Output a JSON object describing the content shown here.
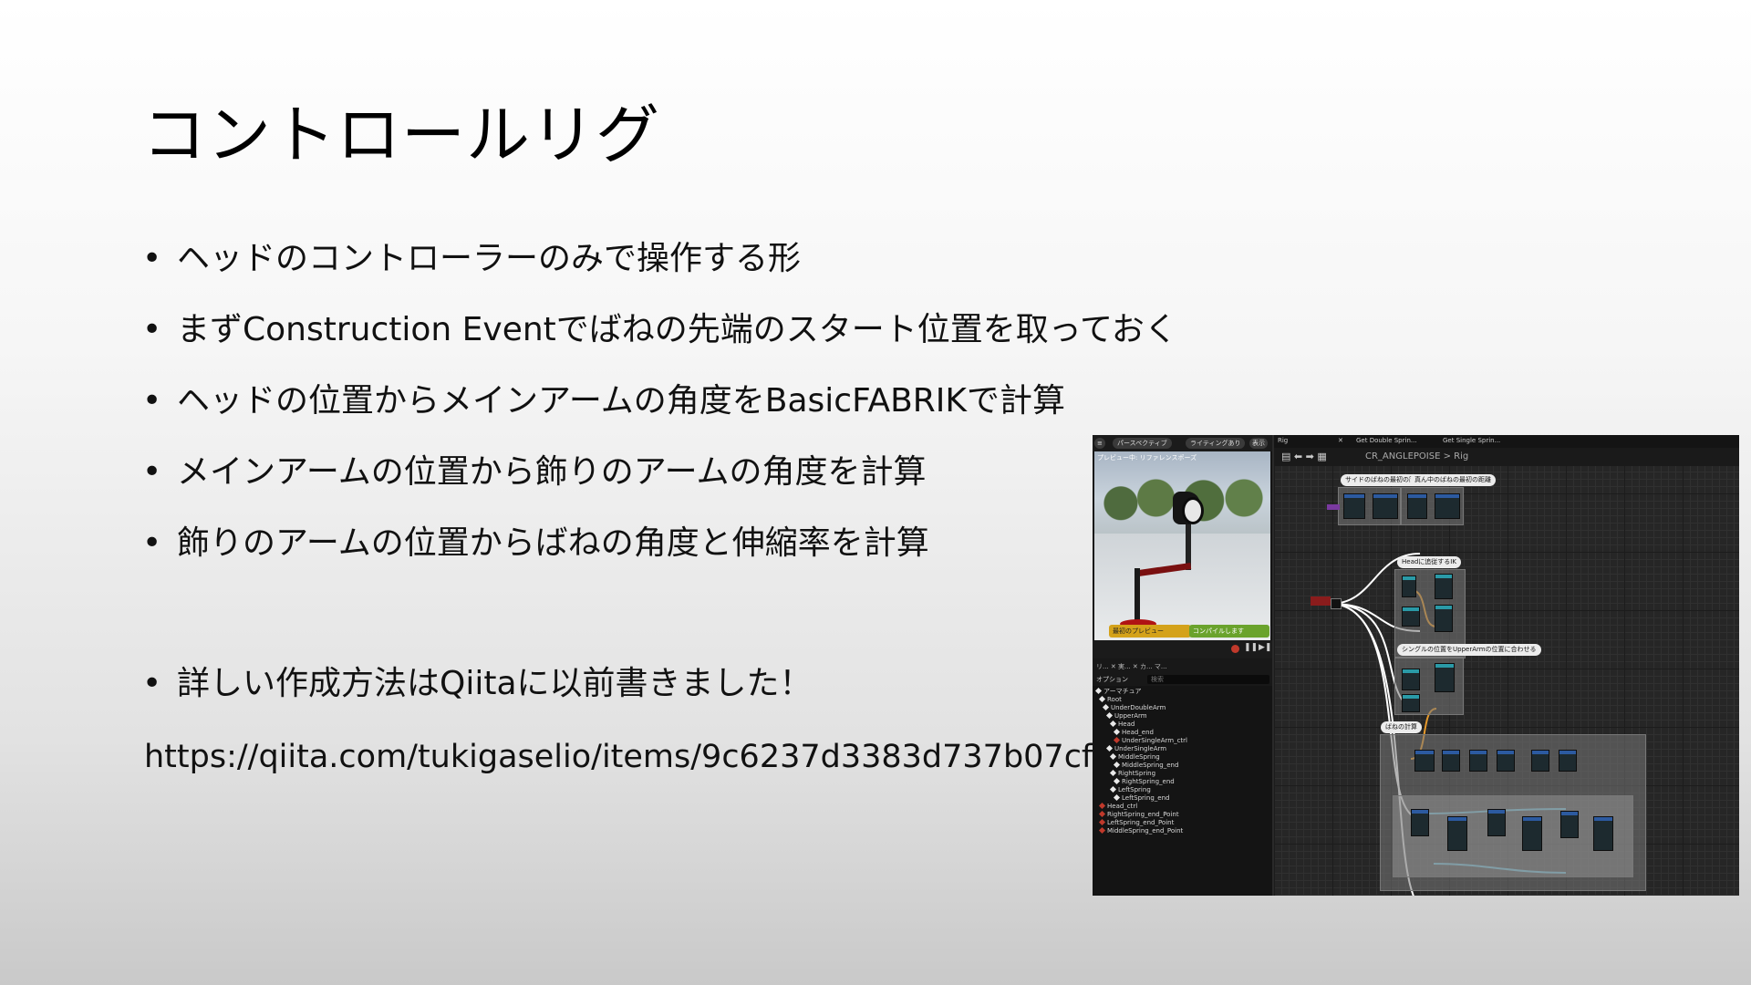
{
  "slide": {
    "title": "コントロールリグ",
    "bullet_symbol": "•",
    "bullets": [
      "ヘッドのコントローラーのみで操作する形",
      "まずConstruction Eventでばねの先端のスタート位置を取っておく",
      "ヘッドの位置からメインアームの角度をBasicFABRIKで計算",
      "メインアームの位置から飾りのアームの角度を計算",
      "飾りのアームの位置からばねの角度と伸縮率を計算",
      "詳しい作成方法はQiitaに以前書きました！"
    ],
    "url": "https://qiita.com/tukigaselio/items/9c6237d3383d737b07cf"
  },
  "editor": {
    "viewport_toolbar": [
      "パースペクティブ",
      "ライティングあり",
      "表示"
    ],
    "viewport_label": "プレビュー中: リファレンスポーズ",
    "preview_button": "最初のプレビュー",
    "compile_button": "コンパイルします",
    "tree_tabs": "リ... ✕  実... ✕  カ...  マ...",
    "tree_options": "オプション",
    "tree_search_placeholder": "検索",
    "tree_items": [
      {
        "label": "アーマチュア",
        "type": "bone"
      },
      {
        "label": "Root",
        "type": "bone"
      },
      {
        "label": "UnderDoubleArm",
        "type": "bone"
      },
      {
        "label": "UpperArm",
        "type": "bone"
      },
      {
        "label": "Head",
        "type": "bone"
      },
      {
        "label": "Head_end",
        "type": "bone"
      },
      {
        "label": "UnderSingleArm_ctrl",
        "type": "ctrl"
      },
      {
        "label": "UnderSingleArm",
        "type": "bone"
      },
      {
        "label": "MiddleSpring",
        "type": "bone"
      },
      {
        "label": "MiddleSpring_end",
        "type": "bone"
      },
      {
        "label": "RightSpring",
        "type": "bone"
      },
      {
        "label": "RightSpring_end",
        "type": "bone"
      },
      {
        "label": "LeftSpring",
        "type": "bone"
      },
      {
        "label": "LeftSpring_end",
        "type": "bone"
      },
      {
        "label": "Head_ctrl",
        "type": "ctrl"
      },
      {
        "label": "RightSpring_end_Point",
        "type": "ctrl"
      },
      {
        "label": "LeftSpring_end_Point",
        "type": "ctrl"
      },
      {
        "label": "MiddleSpring_end_Point",
        "type": "ctrl"
      }
    ],
    "graph_tabs": [
      "Rig",
      "Get Double Sprin...",
      "Get Single Sprin..."
    ],
    "breadcrumb": "CR_ANGLEPOISE > Rig",
    "comments": [
      "サイドのばねの最初の距離",
      "真ん中のばねの最初の距離",
      "Headに追従するIK",
      "シングルの位置をUpperArmの位置に合わせる",
      "ばねの計算"
    ]
  }
}
